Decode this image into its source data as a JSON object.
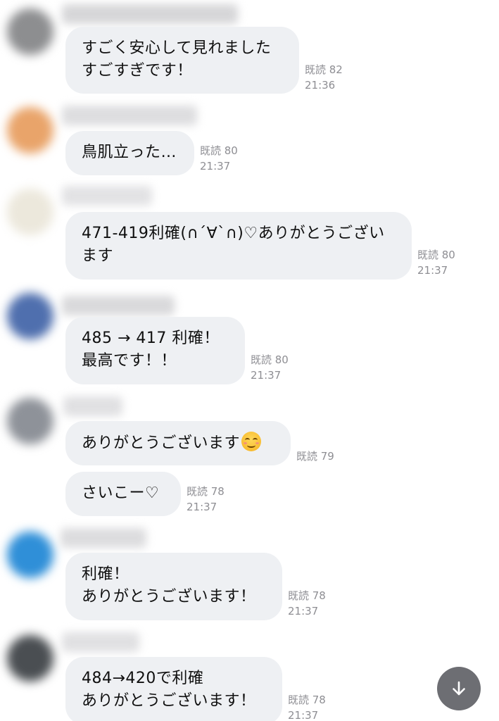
{
  "messages": [
    {
      "lines": [
        "すごく安心して見れました",
        "すごすぎです！"
      ],
      "read": "既読 82",
      "time": "21:36"
    },
    {
      "lines": [
        "鳥肌立った…"
      ],
      "read": "既読 80",
      "time": "21:37"
    },
    {
      "lines": [
        "471-419利確(∩´∀`∩)♡ありがとうござい",
        "ます"
      ],
      "read": "既読 80",
      "time": "21:37"
    },
    {
      "lines": [
        "485 → 417  利確！",
        "最高です！！"
      ],
      "read": "既読 80",
      "time": "21:37"
    },
    {
      "lines": [
        "ありがとうございます"
      ],
      "emoji": "smiling-face-emoji",
      "read": "既読 79"
    },
    {
      "lines": [
        "さいこー♡"
      ],
      "read": "既読 78",
      "time": "21:37"
    },
    {
      "lines": [
        "利確！",
        "ありがとうございます！"
      ],
      "read": "既読 78",
      "time": "21:37"
    },
    {
      "lines": [
        "484→420で利確",
        "ありがとうございます！"
      ],
      "read": "既読 78",
      "time": "21:37"
    }
  ],
  "avatar_colors": [
    "#8d8e90",
    "#e9a46a",
    "#ece8dc",
    "#4f6fae",
    "#8e9299",
    "#2f8fd8",
    "#4a4e52"
  ],
  "scroll_button": {
    "icon": "arrow-down-icon"
  }
}
